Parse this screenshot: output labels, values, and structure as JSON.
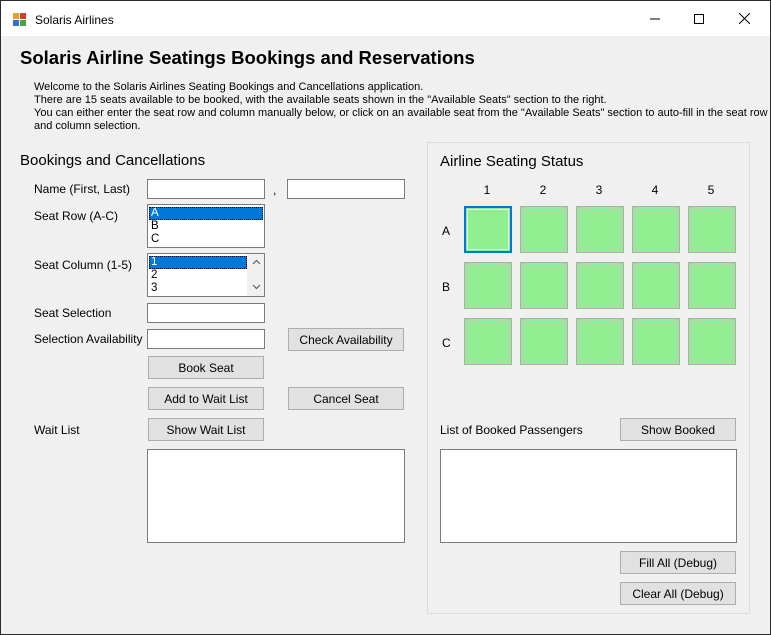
{
  "window": {
    "title": "Solaris Airlines"
  },
  "heading": "Solaris Airline Seatings Bookings and Reservations",
  "intro": [
    "Welcome to the Solaris Airlines Seating Bookings and Cancellations application.",
    "There are 15 seats available to be booked, with the available seats shown in the \"Available Seats\" section to the right.",
    "You can either enter the seat row and column manually below, or click on an available seat from the \"Available Seats\" section to auto-fill in the seat row",
    "and column selection."
  ],
  "bookings": {
    "title": "Bookings and Cancellations",
    "name_label": "Name (First, Last)",
    "name_separator": ",",
    "first_name": "",
    "last_name": "",
    "row_label": "Seat Row (A-C)",
    "row_options": [
      "A",
      "B",
      "C"
    ],
    "column_label": "Seat Column (1-5)",
    "column_options": [
      "1",
      "2",
      "3"
    ],
    "selection_label": "Seat Selection",
    "selection_value": "",
    "availability_label": "Selection Availability",
    "availability_value": "",
    "check_availability_button": "Check Availability",
    "book_seat_button": "Book Seat",
    "add_wait_list_button": "Add to Wait List",
    "cancel_seat_button": "Cancel Seat",
    "wait_list_label": "Wait List",
    "show_wait_list_button": "Show Wait List"
  },
  "seating": {
    "title": "Airline Seating Status",
    "columns": [
      "1",
      "2",
      "3",
      "4",
      "5"
    ],
    "rows": [
      "A",
      "B",
      "C"
    ],
    "seat_color": "#90ee90",
    "booked_label": "List of Booked Passengers",
    "show_booked_button": "Show Booked",
    "fill_all_button": "Fill All (Debug)",
    "clear_all_button": "Clear All (Debug)"
  }
}
